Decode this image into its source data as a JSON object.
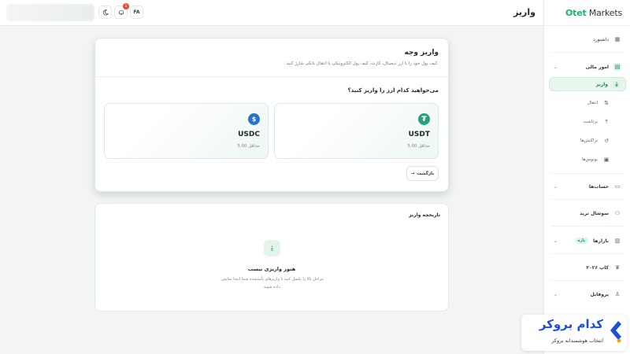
{
  "header": {
    "page_title": "واریز",
    "lang_label": "FA",
    "notification_count": "1"
  },
  "sidebar": {
    "logo_prefix": "Otet",
    "logo_suffix": " Markets",
    "items": {
      "dashboard": "داشبورد",
      "finance": "امور مالی",
      "deposit": "واریز",
      "transfer": "انتقال",
      "withdraw": "برداشت",
      "transactions": "تراکنش‌ها",
      "bonuses": "بونوس‌ها",
      "accounts": "حساب‌ها",
      "social_trade": "سوشال ترید",
      "markets": "بازارها",
      "markets_badge": "تازه",
      "cup": "کاپ ۲۰۲۶",
      "profile": "پروفایل"
    }
  },
  "deposit": {
    "title": "واریز وجه",
    "description": "کیف پول خود را با ارز دیجیتال، کارت، کیف پول الکترونیکی یا انتقال بانکی شارژ کنید.",
    "question": "می‌خواهید کدام ارز را واریز کنید؟",
    "coins": [
      {
        "name": "USDT",
        "min": "حداقل 5.00",
        "symbol": "₮"
      },
      {
        "name": "USDC",
        "min": "حداقل 5.00",
        "symbol": "$"
      }
    ],
    "back_label": "بازگشت",
    "back_arrow": "→"
  },
  "history": {
    "title": "تاریخچه واریز",
    "empty_title": "هنوز واریزی نیست",
    "empty_desc": "مراحل بالا را تکمیل کنید تا واریزهای تأییدشده شما اینجا نمایش داده شوند."
  },
  "watermark": {
    "title": "کدام بروکر",
    "subtitle": "انتخاب هوشمندانه بروکر"
  },
  "colors": {
    "accent": "#20b26b",
    "usdt": "#26a17b",
    "usdc": "#2775ca",
    "watermark_blue": "#1d4fd8"
  }
}
